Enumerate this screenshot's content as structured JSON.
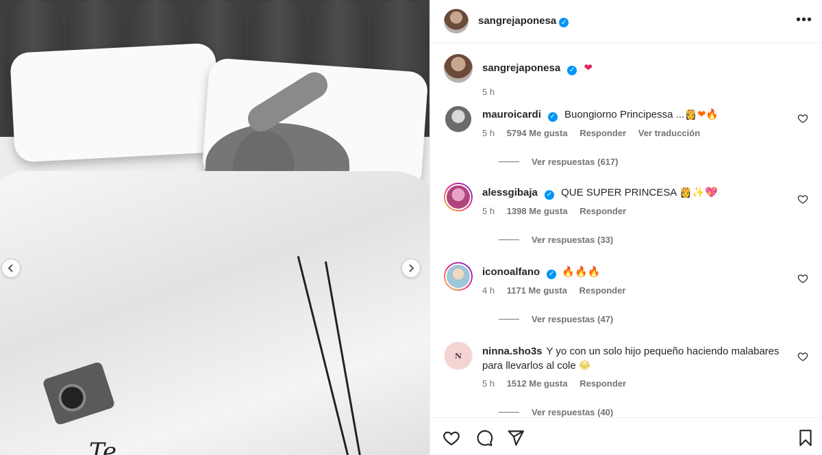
{
  "post": {
    "author": "sangrejaponesa",
    "carousel": {
      "prev_icon": "chevron-left-icon",
      "next_icon": "chevron-right-icon"
    },
    "photo_text": "Te"
  },
  "caption": {
    "username": "sangrejaponesa",
    "text": "❤",
    "time": "5 h"
  },
  "comments": [
    {
      "username": "mauroicardi",
      "verified": true,
      "text": "Buongiorno Principessa ...",
      "emoji": "👸❤🔥",
      "time": "5 h",
      "likes": "5794 Me gusta",
      "reply": "Responder",
      "translate": "Ver traducción",
      "replies": "Ver respuestas (617)"
    },
    {
      "username": "alessgibaja",
      "verified": true,
      "text": "QUE SUPER PRINCESA",
      "emoji": "👸✨💖",
      "time": "5 h",
      "likes": "1398 Me gusta",
      "reply": "Responder",
      "replies": "Ver respuestas (33)"
    },
    {
      "username": "iconoalfano",
      "verified": true,
      "text": "",
      "emoji": "🔥🔥🔥",
      "time": "4 h",
      "likes": "1171 Me gusta",
      "reply": "Responder",
      "replies": "Ver respuestas (47)"
    },
    {
      "username": "ninna.sho3s",
      "verified": false,
      "text": "Y yo con un solo hijo pequeño haciendo malabares para llevarlos al cole",
      "emoji": "😂",
      "time": "5 h",
      "likes": "1512 Me gusta",
      "reply": "Responder",
      "replies": "Ver respuestas (40)"
    }
  ],
  "actions": {
    "like_icon": "heart-icon",
    "comment_icon": "comment-icon",
    "share_icon": "send-icon",
    "save_icon": "bookmark-icon"
  },
  "colors": {
    "verified": "#0095f6",
    "secondary_text": "#737373",
    "divider": "#efefef"
  }
}
